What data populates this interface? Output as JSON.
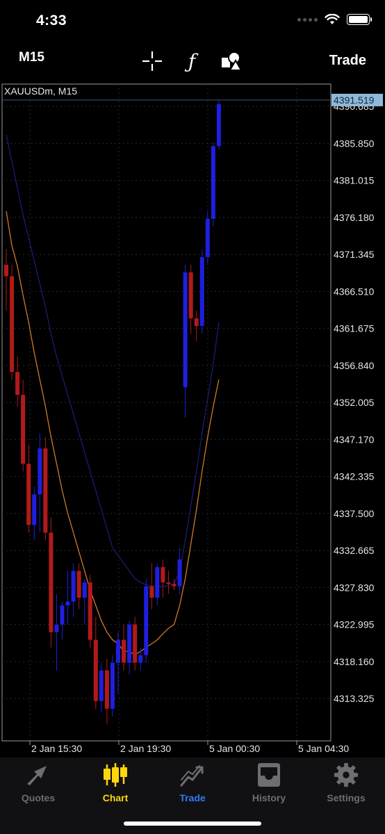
{
  "status_bar": {
    "time": "4:33"
  },
  "toolbar": {
    "timeframe": "M15",
    "indicator_symbol": "ƒ",
    "trade_label": "Trade"
  },
  "chart": {
    "symbol_label": "XAUUSDm, M15",
    "current_price": "4391.519",
    "colors": {
      "bull": "#1f1fe0",
      "bear": "#b21a1a",
      "ma_fast": "#d07a2a",
      "ma_slow": "#1c1c78",
      "grid": "#2a2a2a",
      "price_tag": "#8fb8d8"
    }
  },
  "chart_data": {
    "type": "candlestick",
    "y_axis_ticks": [
      "4390.685",
      "4385.850",
      "4381.015",
      "4376.180",
      "4371.345",
      "4366.510",
      "4361.675",
      "4356.840",
      "4352.005",
      "4347.170",
      "4342.335",
      "4337.500",
      "4332.665",
      "4327.830",
      "4322.995",
      "4318.160",
      "4313.325"
    ],
    "x_axis_ticks": [
      "2 Jan 15:30",
      "2 Jan 19:30",
      "5 Jan 00:30",
      "5 Jan 04:30"
    ],
    "ylim": [
      4307.8,
      4393.6
    ],
    "candles": [
      {
        "o": 4370.0,
        "h": 4372.0,
        "l": 4364.0,
        "c": 4368.5
      },
      {
        "o": 4368.5,
        "h": 4370.0,
        "l": 4355.0,
        "c": 4356.0
      },
      {
        "o": 4356.0,
        "h": 4358.0,
        "l": 4351.5,
        "c": 4353.0
      },
      {
        "o": 4353.0,
        "h": 4355.0,
        "l": 4343.0,
        "c": 4344.0
      },
      {
        "o": 4344.0,
        "h": 4346.5,
        "l": 4335.0,
        "c": 4336.0
      },
      {
        "o": 4336.0,
        "h": 4341.0,
        "l": 4334.0,
        "c": 4340.0
      },
      {
        "o": 4340.0,
        "h": 4348.0,
        "l": 4335.0,
        "c": 4346.0
      },
      {
        "o": 4346.0,
        "h": 4347.5,
        "l": 4334.0,
        "c": 4335.0
      },
      {
        "o": 4335.0,
        "h": 4337.0,
        "l": 4320.0,
        "c": 4322.0
      },
      {
        "o": 4322.0,
        "h": 4327.0,
        "l": 4317.0,
        "c": 4323.0
      },
      {
        "o": 4323.0,
        "h": 4326.0,
        "l": 4321.0,
        "c": 4325.5
      },
      {
        "o": 4325.5,
        "h": 4330.0,
        "l": 4323.0,
        "c": 4326.0
      },
      {
        "o": 4326.0,
        "h": 4331.0,
        "l": 4324.0,
        "c": 4330.0
      },
      {
        "o": 4330.0,
        "h": 4331.0,
        "l": 4325.0,
        "c": 4326.5
      },
      {
        "o": 4326.5,
        "h": 4329.0,
        "l": 4323.0,
        "c": 4328.5
      },
      {
        "o": 4328.5,
        "h": 4329.5,
        "l": 4320.0,
        "c": 4321.0
      },
      {
        "o": 4321.0,
        "h": 4324.0,
        "l": 4312.0,
        "c": 4313.0
      },
      {
        "o": 4313.0,
        "h": 4318.0,
        "l": 4311.5,
        "c": 4317.0
      },
      {
        "o": 4317.0,
        "h": 4318.5,
        "l": 4310.0,
        "c": 4312.0
      },
      {
        "o": 4312.0,
        "h": 4319.0,
        "l": 4311.0,
        "c": 4318.0
      },
      {
        "o": 4318.0,
        "h": 4322.0,
        "l": 4314.0,
        "c": 4321.0
      },
      {
        "o": 4321.0,
        "h": 4323.0,
        "l": 4317.0,
        "c": 4318.0
      },
      {
        "o": 4318.0,
        "h": 4323.5,
        "l": 4316.5,
        "c": 4323.0
      },
      {
        "o": 4323.0,
        "h": 4324.0,
        "l": 4317.0,
        "c": 4318.0
      },
      {
        "o": 4318.0,
        "h": 4320.0,
        "l": 4317.0,
        "c": 4319.0
      },
      {
        "o": 4319.0,
        "h": 4329.0,
        "l": 4318.0,
        "c": 4328.0
      },
      {
        "o": 4328.0,
        "h": 4331.0,
        "l": 4325.0,
        "c": 4326.5
      },
      {
        "o": 4326.5,
        "h": 4331.0,
        "l": 4325.5,
        "c": 4330.5
      },
      {
        "o": 4330.5,
        "h": 4331.5,
        "l": 4326.5,
        "c": 4328.5
      },
      {
        "o": 4328.5,
        "h": 4330.0,
        "l": 4327.0,
        "c": 4328.3
      },
      {
        "o": 4328.3,
        "h": 4329.0,
        "l": 4327.5,
        "c": 4328.0
      },
      {
        "o": 4328.0,
        "h": 4333.0,
        "l": 4327.0,
        "c": 4331.5
      },
      {
        "o": 4354.0,
        "h": 4370.0,
        "l": 4350.0,
        "c": 4369.0
      },
      {
        "o": 4369.0,
        "h": 4370.0,
        "l": 4361.0,
        "c": 4363.0
      },
      {
        "o": 4363.0,
        "h": 4364.0,
        "l": 4360.0,
        "c": 4362.0
      },
      {
        "o": 4362.0,
        "h": 4372.0,
        "l": 4361.0,
        "c": 4371.0
      },
      {
        "o": 4371.0,
        "h": 4377.0,
        "l": 4370.0,
        "c": 4376.0
      },
      {
        "o": 4376.0,
        "h": 4386.0,
        "l": 4375.0,
        "c": 4385.5
      },
      {
        "o": 4385.5,
        "h": 4391.5,
        "l": 4385.0,
        "c": 4391.0
      }
    ],
    "ma_fast": [
      4377,
      4372.5,
      4369.8,
      4366,
      4362.5,
      4358.5,
      4355,
      4351.5,
      4347.5,
      4344,
      4340.5,
      4337.5,
      4335,
      4332.5,
      4330,
      4327.5,
      4325.5,
      4323.5,
      4322,
      4321,
      4320.5,
      4319.5,
      4319.5,
      4319,
      4319.5,
      4320,
      4320.5,
      4321,
      4321.8,
      4322.5,
      4323,
      4325.5,
      4329,
      4333.5,
      4338,
      4343,
      4347.5,
      4351.5,
      4355
    ],
    "ma_slow": [
      4387,
      4383.5,
      4380,
      4376.5,
      4373.5,
      4370.5,
      4367.5,
      4364.5,
      4361,
      4358,
      4355.5,
      4353,
      4350.5,
      4348,
      4345.5,
      4343,
      4340.5,
      4338,
      4335.5,
      4333,
      4332,
      4331,
      4330,
      4329,
      4328.5,
      4328.2,
      4328,
      4328,
      4328,
      4328.1,
      4328.3,
      4330,
      4334,
      4338.5,
      4343,
      4348,
      4352.5,
      4357,
      4362.5
    ],
    "xlabel": "",
    "ylabel": ""
  },
  "tabs": [
    {
      "label": "Quotes",
      "icon": "quotes-arrow-icon"
    },
    {
      "label": "Chart",
      "icon": "candlestick-icon"
    },
    {
      "label": "Trade",
      "icon": "trade-line-icon"
    },
    {
      "label": "History",
      "icon": "inbox-tray-icon"
    },
    {
      "label": "Settings",
      "icon": "gear-icon"
    }
  ]
}
